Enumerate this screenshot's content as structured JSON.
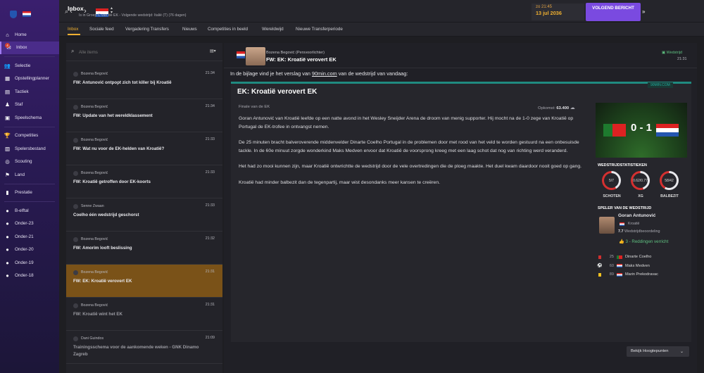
{
  "sidebar": {
    "items": [
      {
        "label": "Home",
        "icon": "home-icon",
        "glyph": "⌂"
      },
      {
        "label": "Inbox",
        "icon": "inbox-icon",
        "glyph": "✉",
        "active": true,
        "badge": "4"
      },
      {
        "label": "Selectie",
        "icon": "squad-icon",
        "glyph": "👥"
      },
      {
        "label": "Opstellingplanner",
        "icon": "lineup-icon",
        "glyph": "▦"
      },
      {
        "label": "Tactiek",
        "icon": "tactics-icon",
        "glyph": "▤"
      },
      {
        "label": "Staf",
        "icon": "staff-icon",
        "glyph": "♟"
      },
      {
        "label": "Speelschema",
        "icon": "schedule-icon",
        "glyph": "▣"
      },
      {
        "label": "Competities",
        "icon": "trophy-icon",
        "glyph": "🏆"
      },
      {
        "label": "Spelersbestand",
        "icon": "database-icon",
        "glyph": "▥"
      },
      {
        "label": "Scouting",
        "icon": "scouting-icon",
        "glyph": "◎"
      },
      {
        "label": "Land",
        "icon": "country-icon",
        "glyph": "⚑"
      },
      {
        "label": "Prestatie",
        "icon": "performance-icon",
        "glyph": "▮"
      },
      {
        "label": "B-elftal",
        "icon": "team-icon",
        "glyph": "●"
      },
      {
        "label": "Onder-23",
        "icon": "team-icon",
        "glyph": "●"
      },
      {
        "label": "Onder-21",
        "icon": "team-icon",
        "glyph": "●"
      },
      {
        "label": "Onder-20",
        "icon": "team-icon",
        "glyph": "●"
      },
      {
        "label": "Onder-19",
        "icon": "team-icon",
        "glyph": "●"
      },
      {
        "label": "Onder-18",
        "icon": "team-icon",
        "glyph": "●"
      }
    ]
  },
  "topbar": {
    "title": "Inbox",
    "subtitle": "Is in Groep C van de EK - Volgende wedstrijd: Italië (T) (76 dagen)",
    "date_line1": "zo 21:45",
    "date_line2": "13 jul 2036",
    "next_button": "VOLGEND BERICHT",
    "fm_label": "FM"
  },
  "tabs": [
    "Inbox",
    "Sociale feed",
    "Vergadering Transfers",
    "Nieuws",
    "Competities in beeld",
    "Wereldwijd",
    "Nieuwe Transferperiode"
  ],
  "list": {
    "search_placeholder": "Alle items",
    "messages": [
      {
        "sender": "Bozena Begović",
        "time": "21:34",
        "subject": "FW: Antunović ontpopt zich tot killer bij Kroatië",
        "read": false
      },
      {
        "sender": "Bozena Begović",
        "time": "21:34",
        "subject": "FW: Update van het wereldklassement",
        "read": false
      },
      {
        "sender": "Bozena Begović",
        "time": "21:33",
        "subject": "FW: Wat nu voor de EK-helden van Kroatië?",
        "read": false
      },
      {
        "sender": "Bozena Begović",
        "time": "21:33",
        "subject": "FW: Kroatië getroffen door EK-koorts",
        "read": false
      },
      {
        "sender": "Senne Zwaan",
        "time": "21:33",
        "subject": "Coelho één wedstrijd geschorst",
        "read": false
      },
      {
        "sender": "Bozena Begović",
        "time": "21:32",
        "subject": "FW: Amorim looft beslissing",
        "read": false
      },
      {
        "sender": "Bozena Begović",
        "time": "21:31",
        "subject": "FW: EK: Kroatië verovert EK",
        "read": false,
        "selected": true
      },
      {
        "sender": "Bozena Begović",
        "time": "21:31",
        "subject": "FW: Kroatië wint het EK",
        "read": true
      },
      {
        "sender": "Dani Guindos",
        "time": "21:09",
        "subject": "Trainingsschema voor de aankomende weken - GNK Dinamo Zagreb",
        "read": true
      }
    ]
  },
  "message": {
    "sender": "Bozena Begović  (Persvoorlichter)",
    "subject": "FW: EK: Kroatië verovert EK",
    "type": "Wedstrijd",
    "time": "21:31",
    "intro_prefix": "In de bijlage vind je het verslag van ",
    "intro_link": "90min.com",
    "intro_suffix": " van de wedstrijd van vandaag:"
  },
  "article": {
    "source": "90MIN.COM",
    "title": "EK: Kroatië verovert EK",
    "stage": "Finale van de EK",
    "attendance_label": "Opkomst: ",
    "attendance_value": "63.400",
    "paragraphs": [
      "Goran Antunović van Kroatië leefde op een natte avond in het Wesley Sneijder Arena de droom van menig supporter. Hij mocht na de 1-0 zege van Kroatië op Portugal de EK-trofee in ontvangst nemen.",
      "De 25 minuten bracht balveroverende middenvelder Dinarte Coelho Portugal in de problemen door met rood van het veld te worden gestuurd na een onbesuisde tackle. In de 60e minuut zorgde wonderkind Maks Medven ervoor dat Kroatië de voorsprong kreeg met een laag schot dat nog van richting werd veranderd.",
      "Het had zo mooi kunnen zijn, maar Kroatië ontwrichtte de wedstrijd door de vele overtredingen die de ploeg maakte. Het duel kwam daardoor nooit goed op gang.",
      "Kroatië had minder balbezit dan de tegenpartij, maar wist desondanks meer kansen te creëren."
    ]
  },
  "match": {
    "score": "0 - 1",
    "stats_title": "WEDSTRIJDSTATISTIEKEN",
    "stats": [
      {
        "label": "SCHOTEN",
        "value": "5/7",
        "home": 5,
        "away": 7
      },
      {
        "label": "XG",
        "value": "0.62/0.77",
        "home": 0.62,
        "away": 0.77
      },
      {
        "label": "BALBEZIT",
        "value": "58/42",
        "home": 58,
        "away": 42
      }
    ],
    "potm_title": "SPELER VAN DE WEDSTRIJD",
    "potm_name": "Goran Antunović",
    "potm_club": "Kroatië",
    "potm_rating_value": "7.7",
    "potm_rating_label": " Wedstrijdbeoordeling",
    "potm_note": "3 - Reddingen verricht",
    "events": [
      {
        "minute": "25",
        "player": "Dinarte Coelho",
        "type": "red-card",
        "color": "#d03030",
        "flag": "pt"
      },
      {
        "minute": "60",
        "player": "Maks Medven",
        "type": "goal",
        "color": "#ffffff",
        "flag": "hr"
      },
      {
        "minute": "89",
        "player": "Marin Prekodravac",
        "type": "yellow-card",
        "color": "#f0c020",
        "flag": "hr"
      }
    ]
  },
  "footer": {
    "highlights_button": "Bekijk Hoogtepunten"
  },
  "colors": {
    "accent": "#f0b030",
    "brand": "#7a4ae0",
    "selected": "#7a5218",
    "success": "#5fc080"
  }
}
